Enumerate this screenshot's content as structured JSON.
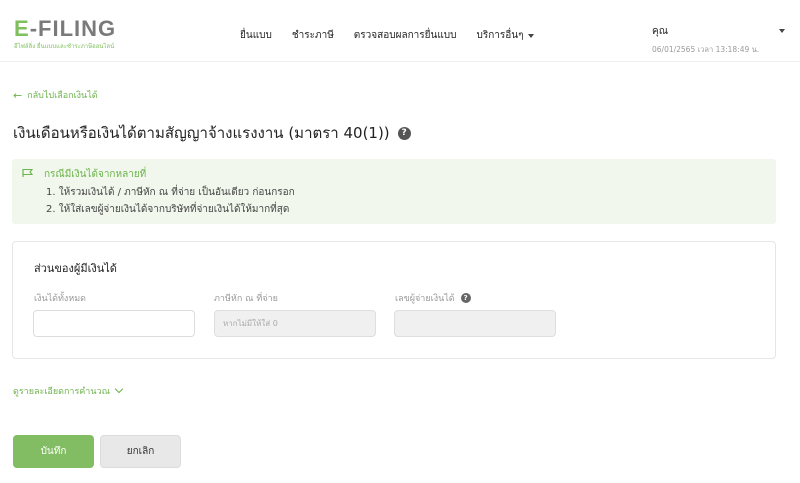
{
  "header": {
    "logo_prefix": "E",
    "logo_suffix": "-FILING",
    "logo_tagline": "อีไฟล์ลิ่ง ยื่นแบบและชำระภาษีออนไลน์",
    "nav": [
      {
        "label": "ยื่นแบบ"
      },
      {
        "label": "ชำระภาษี"
      },
      {
        "label": "ตรวจสอบผลการยื่นแบบ"
      },
      {
        "label": "บริการอื่นๆ"
      }
    ],
    "user_label": "คุณ",
    "timestamp": "06/01/2565 เวลา 13:18:49 น."
  },
  "back_link": "กลับไปเลือกเงินได้",
  "page_title": "เงินเดือนหรือเงินได้ตามสัญญาจ้างแรงงาน (มาตรา 40(1))",
  "notice": {
    "heading": "กรณีมีเงินได้จากหลายที่",
    "lines": [
      "1. ให้รวมเงินได้ / ภาษีหัก ณ ที่จ่าย เป็นอันเดียว ก่อนกรอก",
      "2. ให้ใส่เลขผู้จ่ายเงินได้จากบริษัทที่จ่ายเงินได้ให้มากที่สุด"
    ]
  },
  "card": {
    "title": "ส่วนของผู้มีเงินได้",
    "fields": [
      {
        "label": "เงินได้ทั้งหมด",
        "value": "",
        "placeholder": ""
      },
      {
        "label": "ภาษีหัก ณ ที่จ่าย",
        "value": "",
        "placeholder": "หากไม่มีให้ใส่ 0"
      },
      {
        "label": "เลขผู้จ่ายเงินได้",
        "value": "",
        "placeholder": ""
      }
    ]
  },
  "details_link": "ดูรายละเอียดการคำนวณ",
  "buttons": {
    "save": "บันทึก",
    "cancel": "ยกเลิก"
  },
  "colors": {
    "accent": "#82bd63",
    "notice_bg": "#f1f7ec"
  }
}
